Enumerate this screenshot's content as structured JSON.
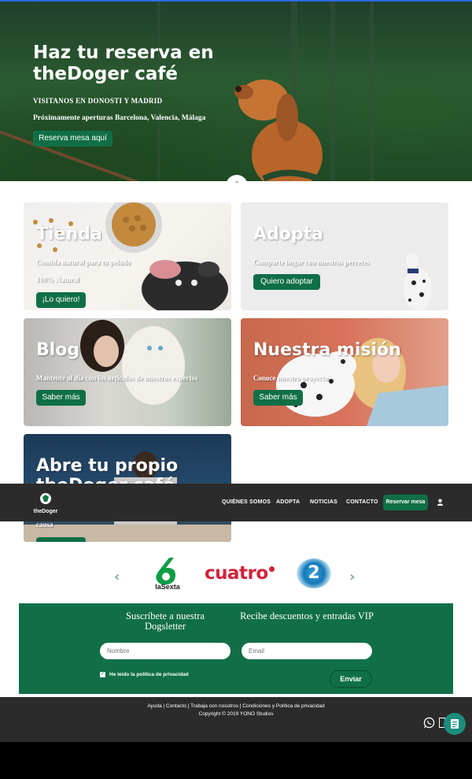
{
  "hero": {
    "title": "Haz tu reserva en theDoger café",
    "subtitle": "VISITANOS EN DONOSTI Y MADRID",
    "subtitle2": "Próximamente aperturas Barcelona, Valencia, Málaga",
    "button": "Reserva mesa aquí"
  },
  "cards": {
    "tienda": {
      "title": "Tienda",
      "text1": "Comida natural para tu peludo",
      "text2": "100% Natural",
      "button": "¡Lo quiero!"
    },
    "adopta": {
      "title": "Adopta",
      "text1": "Comparte hogar con nuestros perretes",
      "button": "Quiero adoptar"
    },
    "blog": {
      "title": "Blog",
      "text1": "Mantente al día con los artículos de nuestros expertos",
      "button": "Saber más"
    },
    "mision": {
      "title": "Nuestra misión",
      "text1": "Conoce nuestro proyecto",
      "button": "Saber más"
    },
    "abre": {
      "title_line1": "Abre tu propio",
      "title_line2": "theDoger café",
      "text1": "causa"
    }
  },
  "nav": {
    "logo_text": "theDoger",
    "items": [
      "QUIÉNES SOMOS",
      "ADOPTA",
      "NOTICIAS",
      "CONTACTO"
    ],
    "cta": "Reservar mesa"
  },
  "carousel": {
    "logos": [
      "laSexta",
      "cuatro",
      "2"
    ],
    "lasexta_number": "6"
  },
  "newsletter": {
    "title_left": "Suscríbete a nuestra Dogsletter",
    "title_right": "Recibe descuentos y entradas VIP",
    "name_placeholder": "Nombre",
    "email_placeholder": "Email",
    "privacy_label": "He leído la política de privacidad",
    "send_button": "Enviar"
  },
  "footer": {
    "links": "Ayuda | Contacto | Trabaja con nosotros | Condiciones y Política de privacidad",
    "copyright": "Copyright © 2019 YONO Studios"
  },
  "colors": {
    "brand_green": "#106f47",
    "dark_bar": "#2b2b2b",
    "cuatro_red": "#d0243b"
  }
}
